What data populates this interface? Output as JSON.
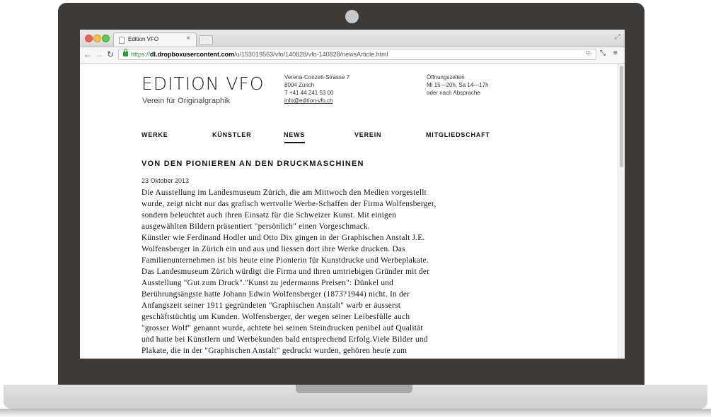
{
  "browser": {
    "tab_title": "Edition VFO",
    "tab_close": "×",
    "url_scheme": "https://",
    "url_host": "dl.dropboxusercontent.com",
    "url_path": "/u/153019563/vfo/140828/vfo-140828/newsArticle.html"
  },
  "site": {
    "logo": "EDITION VFO",
    "tagline": "Verein für Originalgraphik",
    "address": {
      "street": "Verena-Conzett-Strasse 7",
      "city": "8004 Zürich",
      "phone": "T +41 44 241 53 00",
      "email": "info@edition-vfo.ch"
    },
    "hours": {
      "label": "Öffnungszeiten",
      "times": "Mi 15—20h, Sa 14—17h",
      "note": "oder nach Absprache"
    },
    "nav": [
      {
        "label": "WERKE",
        "active": false
      },
      {
        "label": "KÜNSTLER",
        "active": false
      },
      {
        "label": "NEWS",
        "active": true
      },
      {
        "label": "VEREIN",
        "active": false
      },
      {
        "label": "MITGLIEDSCHAFT",
        "active": false
      }
    ]
  },
  "article": {
    "title": "VON DEN PIONIEREN AN DEN DRUCKMASCHINEN",
    "date": "23 Oktober 2013",
    "lines": [
      "Die Ausstellung im Landesmuseum Zürich, die am Mittwoch den Medien vorgestellt",
      "wurde, zeigt nicht nur das grafisch wertvolle Werbe-Schaffen der Firma Wolfensberger,",
      "sondern beleuchtet auch ihren Einsatz für die Schweizer Kunst. Mit einigen",
      "ausgewählten Bildern präsentiert \"persönlich\" einen Vorgeschmack.",
      "Künstler wie Ferdinand Hodler und Otto Dix gingen in der Graphischen Anstalt J.E.",
      "Wolfensberger in Zürich ein und aus und liessen dort ihre Werke drucken. Das",
      "Familienunternehmen ist bis heute eine Pionierin für Kunstdrucke und Werbeplakate.",
      "Das Landesmuseum Zürich würdigt die Firma und ihren umtriebigen Gründer mit der",
      "Ausstellung \"Gut zum Druck\".\"Kunst zu jedermanns Preisen\": Dünkel und",
      "Berührungsängste hatte Johann Edwin Wolfensberger (1873?1944) nicht. In der",
      "Anfangszeit seiner 1911 gegründeten \"Graphischen Anstalt\" warb er äusserst",
      "geschäftstüchtig um Kunden. Wolfensberger, der wegen seiner Leibesfülle auch",
      "\"grosser Wolf\" genannt wurde, achtete bei seinen Steindrucken penibel auf Qualität",
      "und hatte bei Künstlern und Werbekunden bald entsprechend Erfolg.Viele Bilder und",
      "Plakate, die in der \"Graphischen Anstalt\" gedruckt wurden, gehören heute zum"
    ]
  }
}
